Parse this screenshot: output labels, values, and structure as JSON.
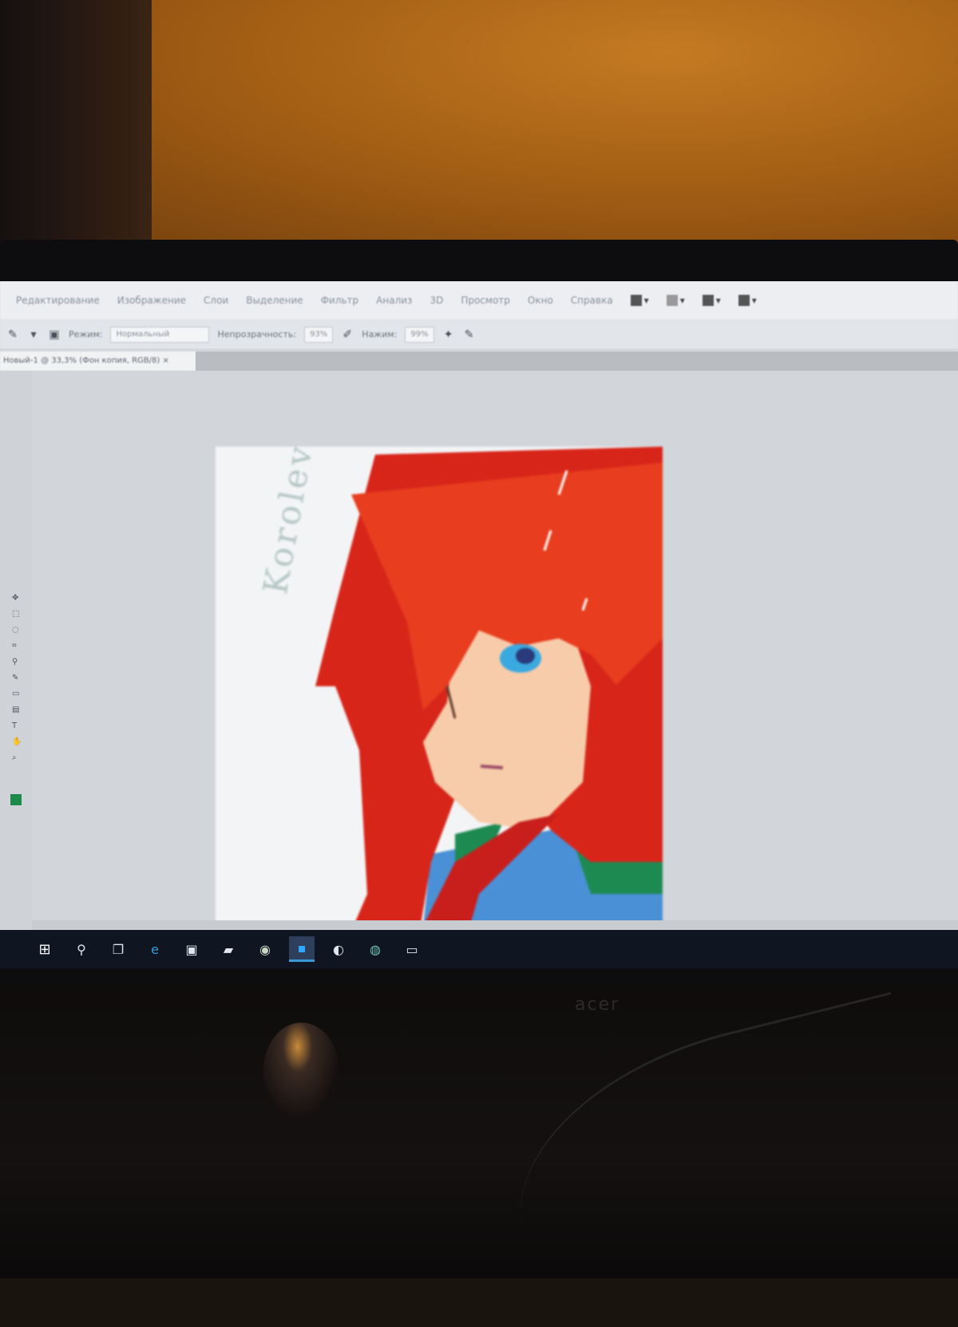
{
  "window": {
    "menus": [
      "Редактирование",
      "Изображение",
      "Слои",
      "Выделение",
      "Фильтр",
      "Анализ",
      "3D",
      "Просмотр",
      "Окно",
      "Справка"
    ]
  },
  "options_bar": {
    "mode_label": "Режим:",
    "mode_value": "Нормальный",
    "opacity_label": "Непрозрачность:",
    "opacity_value": "93%",
    "pressure_label": "Нажим:",
    "pressure_value": "99%"
  },
  "document": {
    "tab_title": "Новый-1 @ 33,3% (Фон копия, RGB/8)"
  },
  "artwork": {
    "signature_text": "Koroleva Lissya"
  },
  "colors": {
    "foreground": "#1c8a4a",
    "taskbar": "#0f1622",
    "taskbar_active": "#3a9ad9"
  },
  "taskbar": {
    "icons": [
      "start-icon",
      "search-icon",
      "task-view-icon",
      "edge-icon",
      "store-icon",
      "folder-icon",
      "chrome-icon",
      "photoshop-icon",
      "opera-icon",
      "browser-icon",
      "explorer-icon"
    ]
  }
}
